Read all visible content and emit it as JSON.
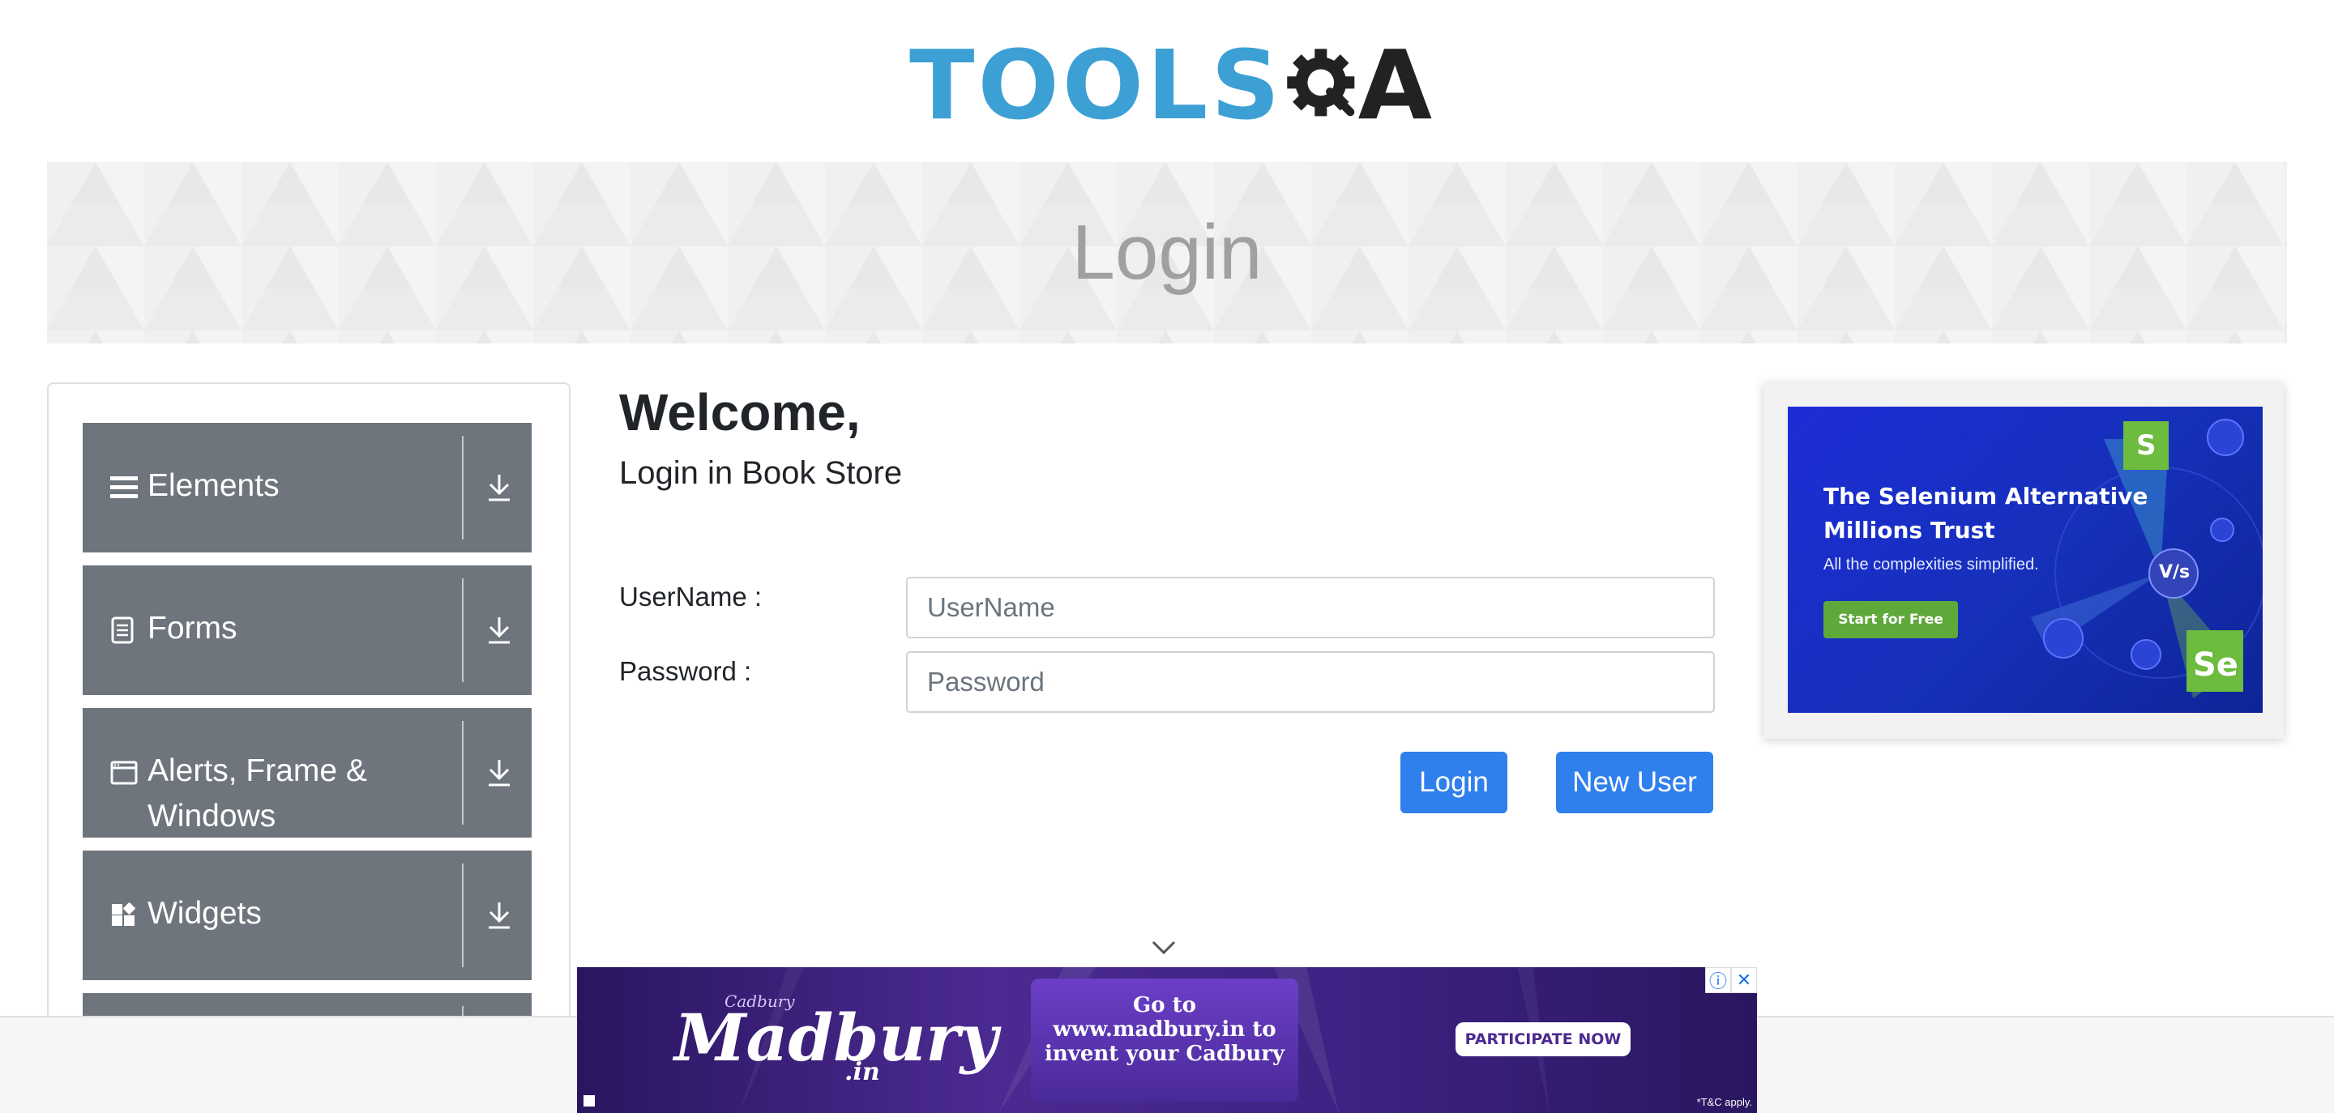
{
  "header": {
    "logo_text": "TOOLS",
    "logo_suffix": "A",
    "logo_alt": "TOOLSQA"
  },
  "banner": {
    "title": "Login"
  },
  "sidebar": {
    "groups": [
      {
        "label": "Elements",
        "icon": "menu-icon"
      },
      {
        "label": "Forms",
        "icon": "document-icon"
      },
      {
        "label": "Alerts, Frame & Windows",
        "icon": "window-icon"
      },
      {
        "label": "Widgets",
        "icon": "widgets-icon"
      }
    ]
  },
  "main": {
    "welcome": "Welcome,",
    "subtitle": "Login in Book Store",
    "username_label": "UserName :",
    "username_placeholder": "UserName",
    "password_label": "Password :",
    "password_placeholder": "Password",
    "login_button": "Login",
    "new_user_button": "New User"
  },
  "side_ad": {
    "title": "The Selenium Alternative Millions Trust",
    "subtitle": "All the complexities simplified.",
    "cta": "Start for Free",
    "vs": "V/s",
    "brand_s": "S",
    "brand_se": "Se"
  },
  "bottom_ad": {
    "brand_small": "Cadbury",
    "brand": "Madbury",
    "brand_suffix": ".in",
    "wrapper_text": "Go to www.madbury.in to invent your Cadbury",
    "cta": "PARTICIPATE NOW",
    "tnc": "*T&C apply."
  },
  "colors": {
    "sidebar_group_bg": "#6e757c",
    "primary_button": "#2f80ed",
    "logo_blue": "#3da0d5"
  }
}
